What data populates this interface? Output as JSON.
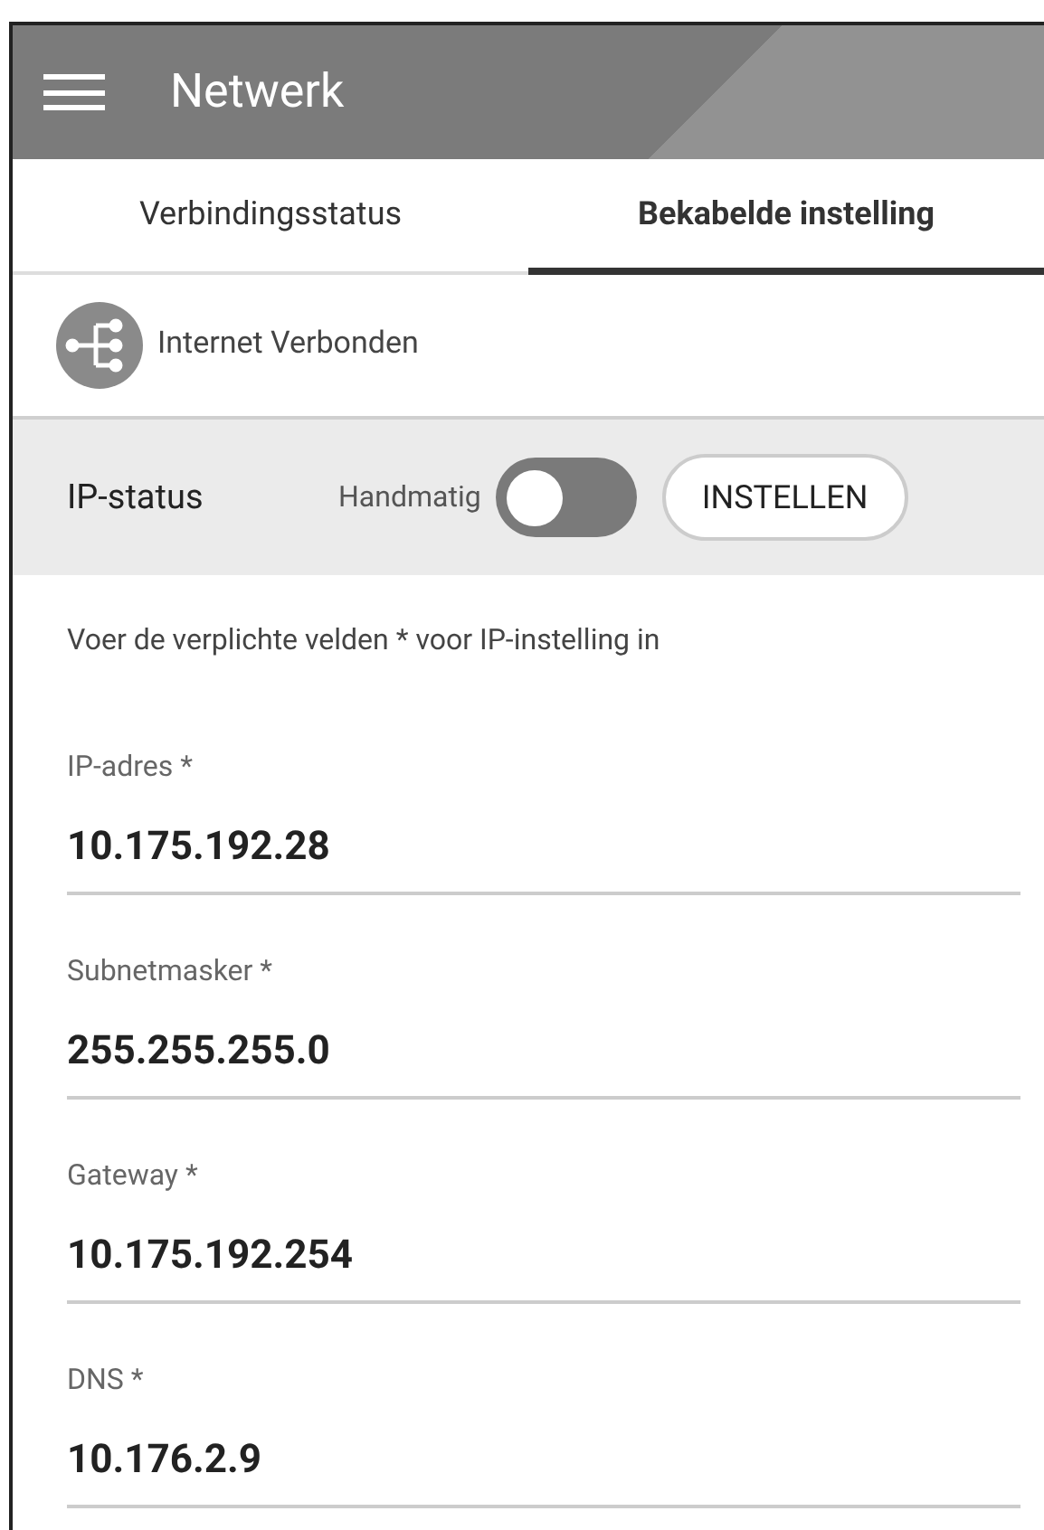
{
  "header": {
    "title": "Netwerk"
  },
  "tabs": [
    {
      "label": "Verbindingsstatus",
      "selected": false
    },
    {
      "label": "Bekabelde instelling",
      "selected": true
    }
  ],
  "connection": {
    "status": "Internet Verbonden"
  },
  "ip_status": {
    "label": "IP-status",
    "mode_label": "Handmatig",
    "on": false,
    "button": "INSTELLEN"
  },
  "instruction": "Voer de verplichte velden * voor IP-instelling in",
  "fields": [
    {
      "label": "IP-adres *",
      "value": "10.175.192.28"
    },
    {
      "label": "Subnetmasker *",
      "value": "255.255.255.0"
    },
    {
      "label": "Gateway *",
      "value": "10.175.192.254"
    },
    {
      "label": "DNS *",
      "value": "10.176.2.9"
    }
  ]
}
